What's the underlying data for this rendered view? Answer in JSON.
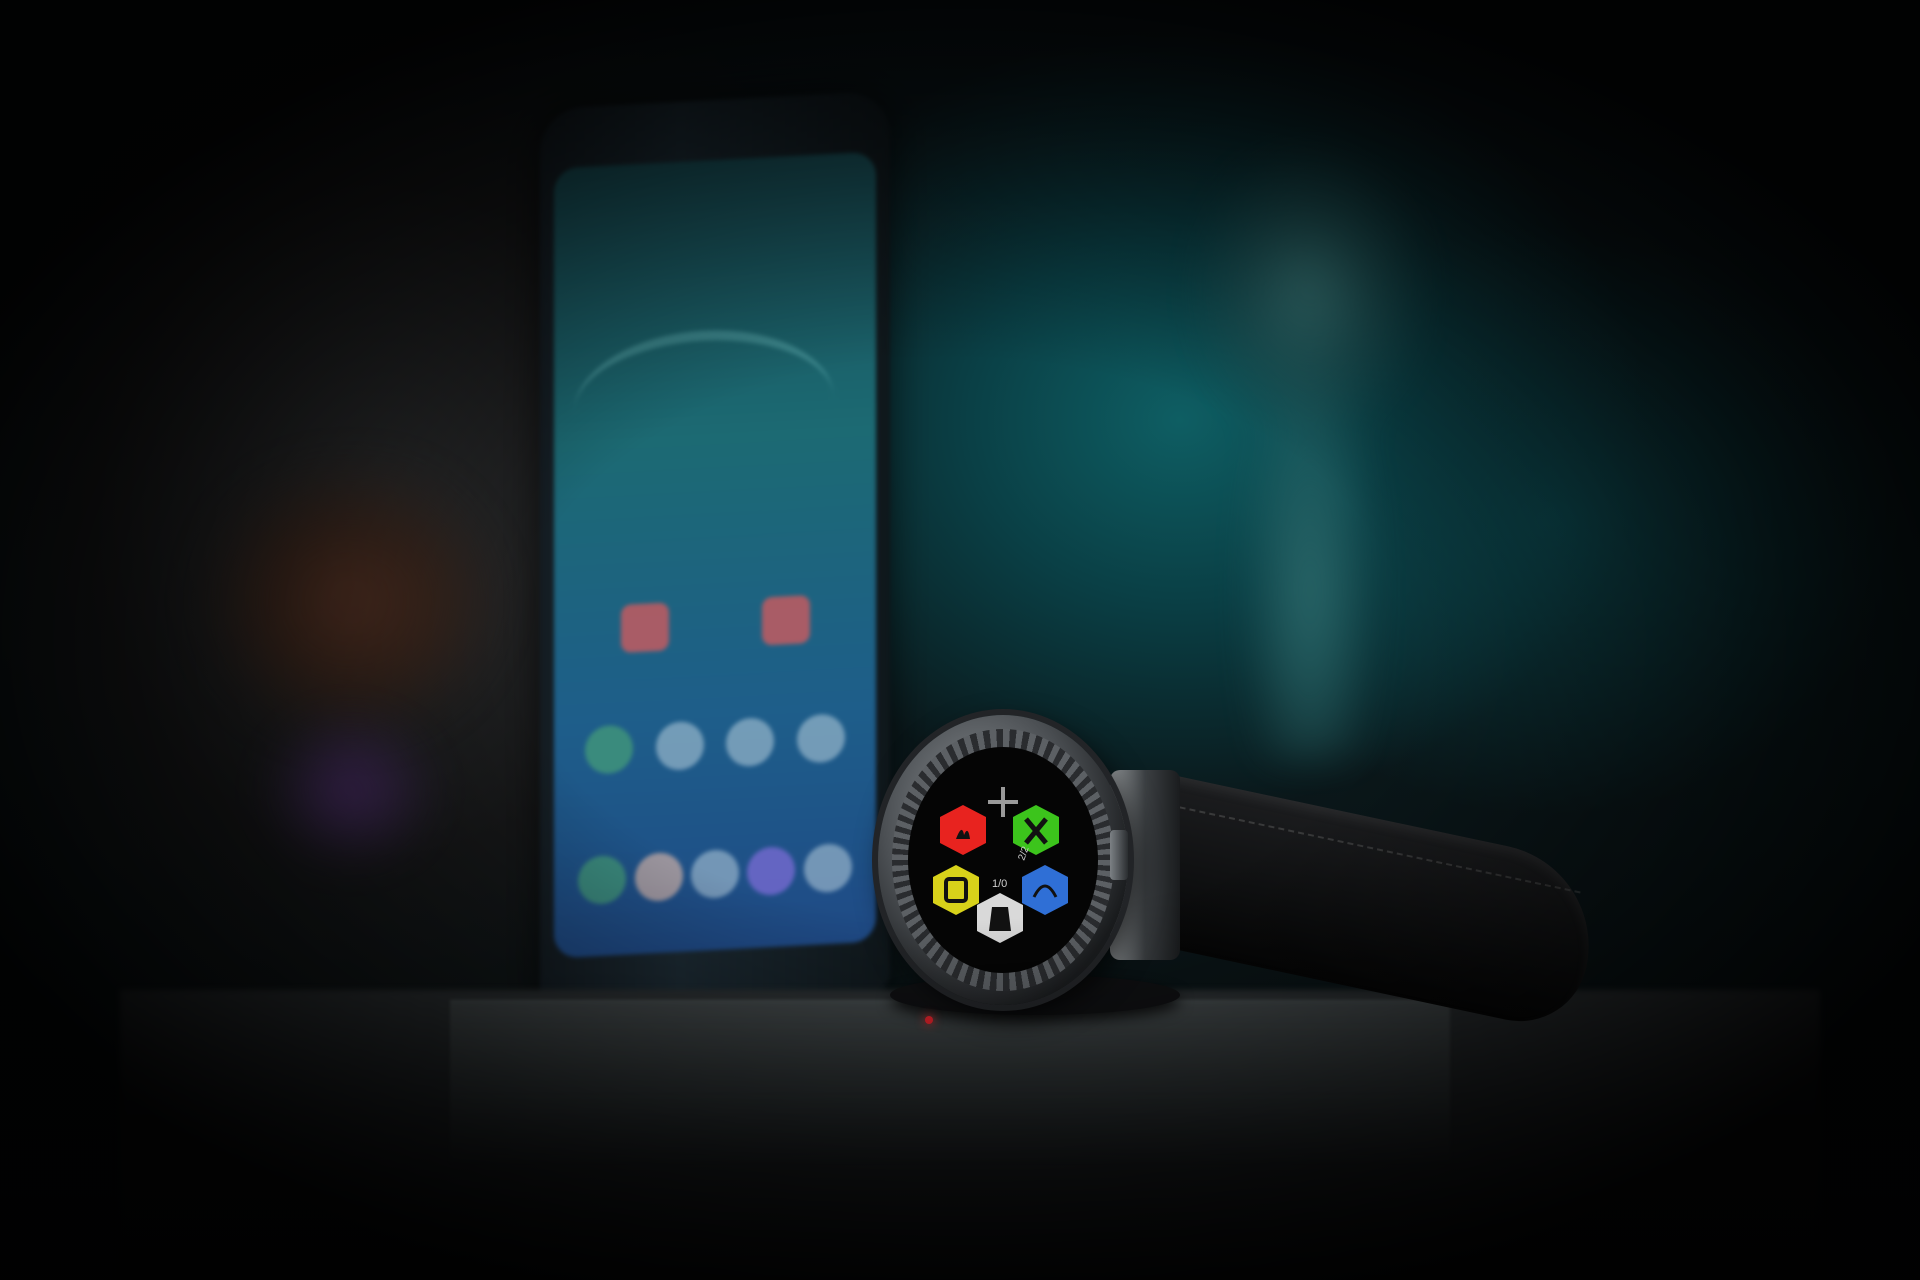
{
  "photo": {
    "scene": "smartwatch-on-display-stand",
    "accent_colors": {
      "teal_background": "#0e5e63",
      "hex_red": "#e8231f",
      "hex_green": "#3cc41c",
      "hex_yellow": "#d8d21a",
      "hex_blue": "#2f6fd6",
      "hex_white": "#d9d9d9",
      "led_red": "#e0232b"
    },
    "watch_face": {
      "tiles": [
        {
          "color": "red",
          "icon": "flames-icon"
        },
        {
          "color": "green",
          "icon": "fork-knife-icon"
        },
        {
          "color": "yellow",
          "icon": "trash-sort-icon"
        },
        {
          "color": "white",
          "icon": "bag-icon"
        },
        {
          "color": "blue",
          "icon": "water-spray-icon"
        }
      ],
      "center_label": "1/0",
      "side_label": "2/2"
    }
  }
}
